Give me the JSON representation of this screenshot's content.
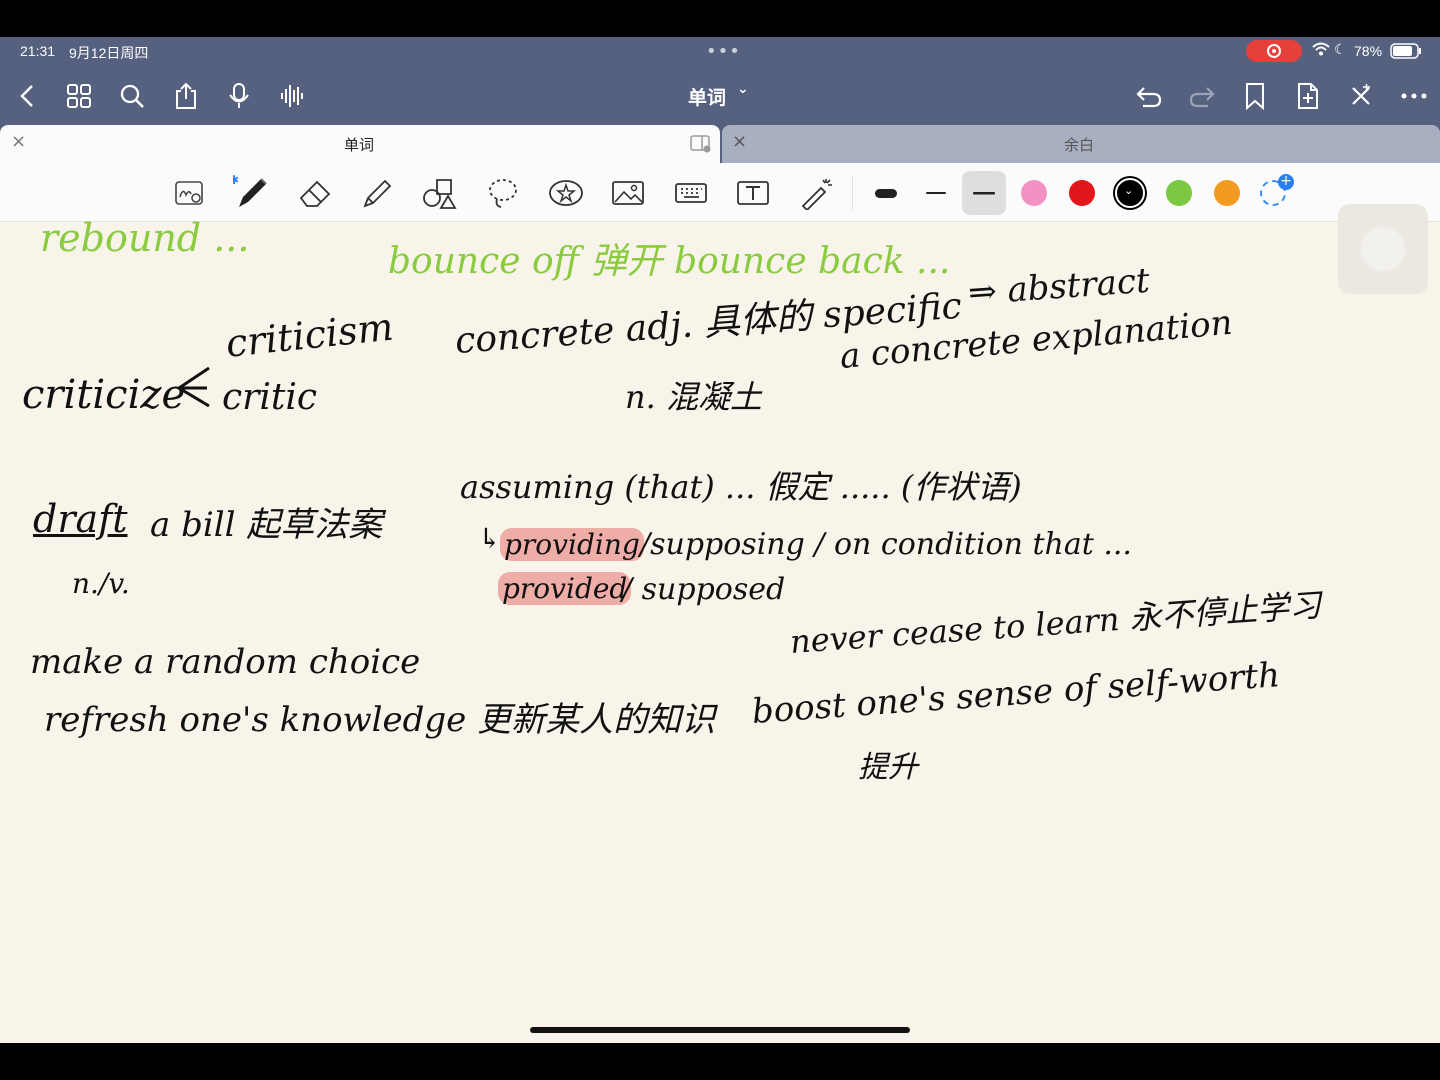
{
  "status": {
    "time": "21:31",
    "date": "9月12日周四",
    "battery": "78%"
  },
  "header": {
    "title": "单词",
    "chevron": "⌄"
  },
  "tabs": [
    {
      "label": "单词",
      "close": "×"
    },
    {
      "label": "余白",
      "close": "×"
    }
  ],
  "toolbar": {
    "tools": [
      "zoom-handwriting-icon",
      "pen-icon",
      "eraser-icon",
      "highlighter-icon",
      "shapes-icon",
      "lasso-icon",
      "sticker-icon",
      "image-icon",
      "keyboard-icon",
      "text-box-icon",
      "laser-pointer-icon"
    ],
    "colors": [
      "#f291c4",
      "#e0161b",
      "#000000",
      "#7cc842",
      "#f39a21"
    ]
  },
  "notes": {
    "top_left": "rebound ...",
    "top_mid": "bounce off 弹开  bounce back ...",
    "concrete1": "concrete  adj. 具体的  specific",
    "concrete_arrow": "⇒ abstract",
    "concrete2": "n. 混凝土",
    "concrete3": "a concrete explanation",
    "criticize": "criticize",
    "criticism": "criticism",
    "critic": "critic",
    "draft": "draft",
    "draft_rest": "a bill 起草法案",
    "draft_pos": "n./v.",
    "assuming": "assuming (that) ... 假定 ..... (作状语)",
    "providing_mark": "↳",
    "providing": "providing",
    "supposing": "/supposing / on condition that ...",
    "provided": "provided",
    "supposed": "/ supposed",
    "random": "make a random choice",
    "refresh": "refresh one's knowledge 更新某人的知识",
    "cease": "never cease to learn 永不停止学习",
    "boost": "boost one's sense of self-worth",
    "boost_cn": "提升"
  }
}
